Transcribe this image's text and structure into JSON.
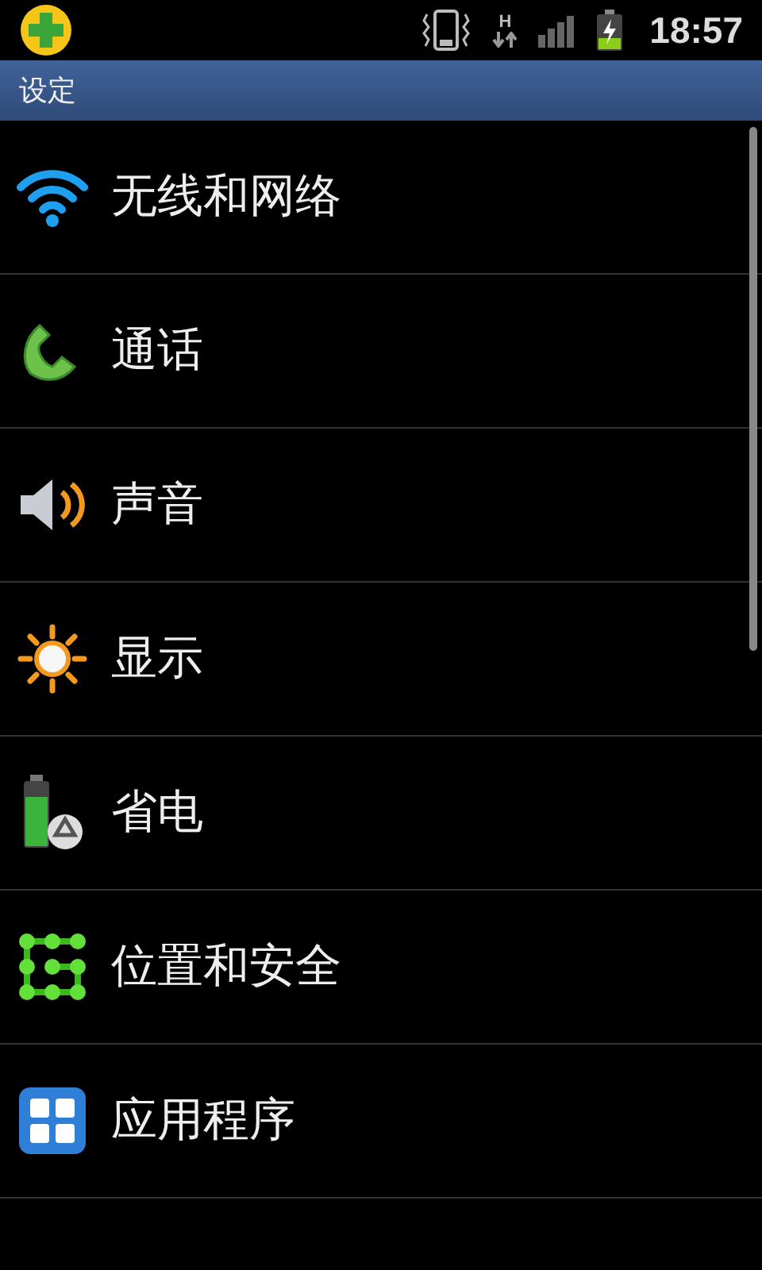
{
  "status_bar": {
    "network_type": "H",
    "time": "18:57"
  },
  "title_bar": {
    "title": "设定"
  },
  "settings": [
    {
      "label": "无线和网络"
    },
    {
      "label": "通话"
    },
    {
      "label": "声音"
    },
    {
      "label": "显示"
    },
    {
      "label": "省电"
    },
    {
      "label": "位置和安全"
    },
    {
      "label": "应用程序"
    }
  ]
}
